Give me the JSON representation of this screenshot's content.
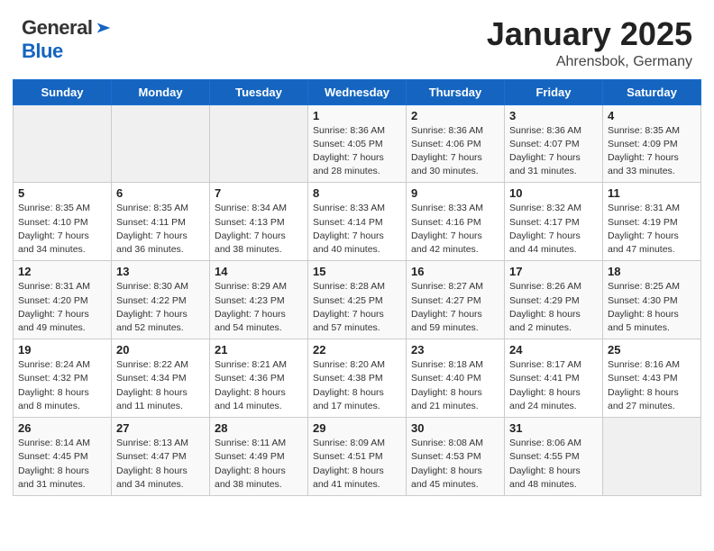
{
  "logo": {
    "general": "General",
    "blue": "Blue"
  },
  "calendar": {
    "title": "January 2025",
    "location": "Ahrensbok, Germany",
    "headers": [
      "Sunday",
      "Monday",
      "Tuesday",
      "Wednesday",
      "Thursday",
      "Friday",
      "Saturday"
    ],
    "weeks": [
      [
        {
          "day": "",
          "sunrise": "",
          "sunset": "",
          "daylight": ""
        },
        {
          "day": "",
          "sunrise": "",
          "sunset": "",
          "daylight": ""
        },
        {
          "day": "",
          "sunrise": "",
          "sunset": "",
          "daylight": ""
        },
        {
          "day": "1",
          "sunrise": "Sunrise: 8:36 AM",
          "sunset": "Sunset: 4:05 PM",
          "daylight": "Daylight: 7 hours and 28 minutes."
        },
        {
          "day": "2",
          "sunrise": "Sunrise: 8:36 AM",
          "sunset": "Sunset: 4:06 PM",
          "daylight": "Daylight: 7 hours and 30 minutes."
        },
        {
          "day": "3",
          "sunrise": "Sunrise: 8:36 AM",
          "sunset": "Sunset: 4:07 PM",
          "daylight": "Daylight: 7 hours and 31 minutes."
        },
        {
          "day": "4",
          "sunrise": "Sunrise: 8:35 AM",
          "sunset": "Sunset: 4:09 PM",
          "daylight": "Daylight: 7 hours and 33 minutes."
        }
      ],
      [
        {
          "day": "5",
          "sunrise": "Sunrise: 8:35 AM",
          "sunset": "Sunset: 4:10 PM",
          "daylight": "Daylight: 7 hours and 34 minutes."
        },
        {
          "day": "6",
          "sunrise": "Sunrise: 8:35 AM",
          "sunset": "Sunset: 4:11 PM",
          "daylight": "Daylight: 7 hours and 36 minutes."
        },
        {
          "day": "7",
          "sunrise": "Sunrise: 8:34 AM",
          "sunset": "Sunset: 4:13 PM",
          "daylight": "Daylight: 7 hours and 38 minutes."
        },
        {
          "day": "8",
          "sunrise": "Sunrise: 8:33 AM",
          "sunset": "Sunset: 4:14 PM",
          "daylight": "Daylight: 7 hours and 40 minutes."
        },
        {
          "day": "9",
          "sunrise": "Sunrise: 8:33 AM",
          "sunset": "Sunset: 4:16 PM",
          "daylight": "Daylight: 7 hours and 42 minutes."
        },
        {
          "day": "10",
          "sunrise": "Sunrise: 8:32 AM",
          "sunset": "Sunset: 4:17 PM",
          "daylight": "Daylight: 7 hours and 44 minutes."
        },
        {
          "day": "11",
          "sunrise": "Sunrise: 8:31 AM",
          "sunset": "Sunset: 4:19 PM",
          "daylight": "Daylight: 7 hours and 47 minutes."
        }
      ],
      [
        {
          "day": "12",
          "sunrise": "Sunrise: 8:31 AM",
          "sunset": "Sunset: 4:20 PM",
          "daylight": "Daylight: 7 hours and 49 minutes."
        },
        {
          "day": "13",
          "sunrise": "Sunrise: 8:30 AM",
          "sunset": "Sunset: 4:22 PM",
          "daylight": "Daylight: 7 hours and 52 minutes."
        },
        {
          "day": "14",
          "sunrise": "Sunrise: 8:29 AM",
          "sunset": "Sunset: 4:23 PM",
          "daylight": "Daylight: 7 hours and 54 minutes."
        },
        {
          "day": "15",
          "sunrise": "Sunrise: 8:28 AM",
          "sunset": "Sunset: 4:25 PM",
          "daylight": "Daylight: 7 hours and 57 minutes."
        },
        {
          "day": "16",
          "sunrise": "Sunrise: 8:27 AM",
          "sunset": "Sunset: 4:27 PM",
          "daylight": "Daylight: 7 hours and 59 minutes."
        },
        {
          "day": "17",
          "sunrise": "Sunrise: 8:26 AM",
          "sunset": "Sunset: 4:29 PM",
          "daylight": "Daylight: 8 hours and 2 minutes."
        },
        {
          "day": "18",
          "sunrise": "Sunrise: 8:25 AM",
          "sunset": "Sunset: 4:30 PM",
          "daylight": "Daylight: 8 hours and 5 minutes."
        }
      ],
      [
        {
          "day": "19",
          "sunrise": "Sunrise: 8:24 AM",
          "sunset": "Sunset: 4:32 PM",
          "daylight": "Daylight: 8 hours and 8 minutes."
        },
        {
          "day": "20",
          "sunrise": "Sunrise: 8:22 AM",
          "sunset": "Sunset: 4:34 PM",
          "daylight": "Daylight: 8 hours and 11 minutes."
        },
        {
          "day": "21",
          "sunrise": "Sunrise: 8:21 AM",
          "sunset": "Sunset: 4:36 PM",
          "daylight": "Daylight: 8 hours and 14 minutes."
        },
        {
          "day": "22",
          "sunrise": "Sunrise: 8:20 AM",
          "sunset": "Sunset: 4:38 PM",
          "daylight": "Daylight: 8 hours and 17 minutes."
        },
        {
          "day": "23",
          "sunrise": "Sunrise: 8:18 AM",
          "sunset": "Sunset: 4:40 PM",
          "daylight": "Daylight: 8 hours and 21 minutes."
        },
        {
          "day": "24",
          "sunrise": "Sunrise: 8:17 AM",
          "sunset": "Sunset: 4:41 PM",
          "daylight": "Daylight: 8 hours and 24 minutes."
        },
        {
          "day": "25",
          "sunrise": "Sunrise: 8:16 AM",
          "sunset": "Sunset: 4:43 PM",
          "daylight": "Daylight: 8 hours and 27 minutes."
        }
      ],
      [
        {
          "day": "26",
          "sunrise": "Sunrise: 8:14 AM",
          "sunset": "Sunset: 4:45 PM",
          "daylight": "Daylight: 8 hours and 31 minutes."
        },
        {
          "day": "27",
          "sunrise": "Sunrise: 8:13 AM",
          "sunset": "Sunset: 4:47 PM",
          "daylight": "Daylight: 8 hours and 34 minutes."
        },
        {
          "day": "28",
          "sunrise": "Sunrise: 8:11 AM",
          "sunset": "Sunset: 4:49 PM",
          "daylight": "Daylight: 8 hours and 38 minutes."
        },
        {
          "day": "29",
          "sunrise": "Sunrise: 8:09 AM",
          "sunset": "Sunset: 4:51 PM",
          "daylight": "Daylight: 8 hours and 41 minutes."
        },
        {
          "day": "30",
          "sunrise": "Sunrise: 8:08 AM",
          "sunset": "Sunset: 4:53 PM",
          "daylight": "Daylight: 8 hours and 45 minutes."
        },
        {
          "day": "31",
          "sunrise": "Sunrise: 8:06 AM",
          "sunset": "Sunset: 4:55 PM",
          "daylight": "Daylight: 8 hours and 48 minutes."
        },
        {
          "day": "",
          "sunrise": "",
          "sunset": "",
          "daylight": ""
        }
      ]
    ]
  }
}
